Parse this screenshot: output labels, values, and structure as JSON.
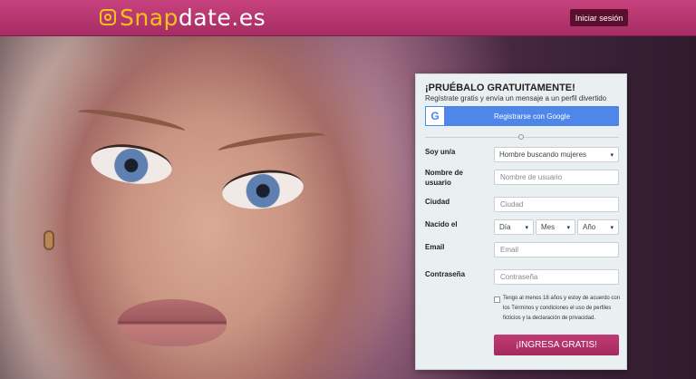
{
  "header": {
    "logo_part1": "Snap",
    "logo_part2": "date.es",
    "login_label": "Iniciar sesión"
  },
  "form": {
    "title": "¡PRUÉBALO GRATUITAMENTE!",
    "subtitle": "Regístrate gratis y envía un mensaje a un perfil divertido",
    "google_label": "Registrarse con Google",
    "gender_label": "Soy un/a",
    "gender_value": "Hombre buscando mujeres",
    "username_label": "Nombre de usuario",
    "username_placeholder": "Nombre de usuario",
    "city_label": "Ciudad",
    "city_placeholder": "Ciudad",
    "birth_label": "Nacido el",
    "day_value": "Día",
    "month_value": "Mes",
    "year_value": "Año",
    "email_label": "Email",
    "email_placeholder": "Email",
    "password_label": "Contraseña",
    "password_placeholder": "Contraseña",
    "terms_text_1": "Tengo al menos 18 años y estoy de acuerdo con los ",
    "terms_link_1": "Términos y condiciones",
    "terms_text_2": " el uso de perfiles ficticios y la ",
    "terms_link_2": "declaración de privacidad",
    "terms_text_3": ".",
    "submit_label": "¡INGRESA GRATIS!"
  },
  "colors": {
    "brand_pink": "#b0336a",
    "logo_yellow": "#f6c21a",
    "google_blue": "#4e86ea"
  }
}
